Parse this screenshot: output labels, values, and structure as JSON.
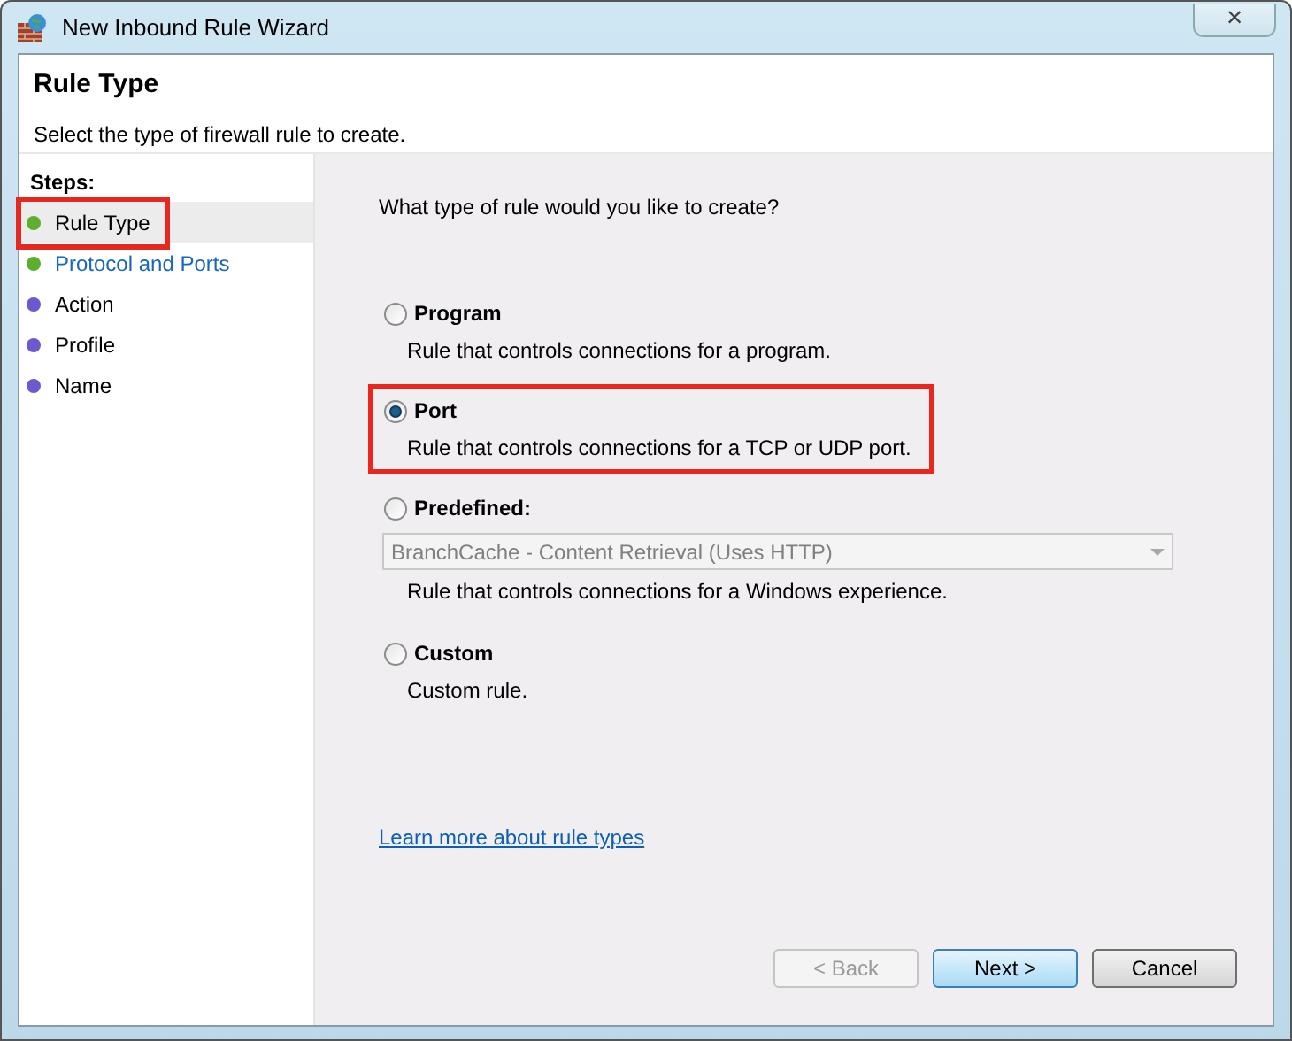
{
  "window": {
    "title": "New Inbound Rule Wizard",
    "close": "×"
  },
  "header": {
    "title": "Rule Type",
    "subtitle": "Select the type of firewall rule to create."
  },
  "steps": {
    "heading": "Steps:",
    "items": [
      {
        "label": "Rule Type",
        "selected": true,
        "link": false,
        "highlighted": true,
        "color": "#5cb02e"
      },
      {
        "label": "Protocol and Ports",
        "selected": false,
        "link": true,
        "highlighted": false,
        "color": "#5cb02e"
      },
      {
        "label": "Action",
        "selected": false,
        "link": false,
        "highlighted": false,
        "color": "#6a5acd"
      },
      {
        "label": "Profile",
        "selected": false,
        "link": false,
        "highlighted": false,
        "color": "#6a5acd"
      },
      {
        "label": "Name",
        "selected": false,
        "link": false,
        "highlighted": false,
        "color": "#6a5acd"
      }
    ]
  },
  "question": "What type of rule would you like to create?",
  "options": [
    {
      "label": "Program",
      "description": "Rule that controls connections for a program.",
      "selected": false,
      "highlighted": false
    },
    {
      "label": "Port",
      "description": "Rule that controls connections for a TCP or UDP port.",
      "selected": true,
      "highlighted": true
    },
    {
      "label": "Predefined:",
      "description": "Rule that controls connections for a Windows experience.",
      "selected": false,
      "highlighted": false,
      "dropdown": {
        "value": "BranchCache - Content Retrieval (Uses HTTP)",
        "disabled": true
      }
    },
    {
      "label": "Custom",
      "description": "Custom rule.",
      "selected": false,
      "highlighted": false
    }
  ],
  "learn_more_link": "Learn more about rule types",
  "buttons": [
    {
      "label": "< Back",
      "disabled": true,
      "default": false
    },
    {
      "label": "Next >",
      "disabled": false,
      "default": true
    },
    {
      "label": "Cancel",
      "disabled": false,
      "default": false
    }
  ]
}
